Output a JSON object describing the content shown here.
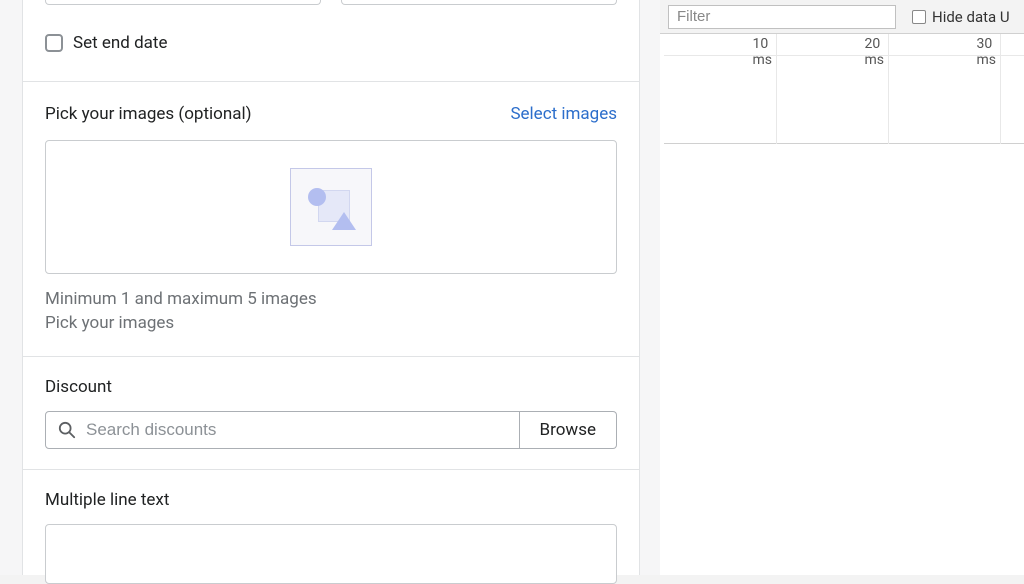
{
  "form": {
    "set_end_date_label": "Set end date",
    "images": {
      "title": "Pick your images (optional)",
      "select_link": "Select images",
      "help_line1": "Minimum 1 and maximum 5 images",
      "help_line2": "Pick your images"
    },
    "discount": {
      "title": "Discount",
      "search_placeholder": "Search discounts",
      "browse_label": "Browse"
    },
    "mlt": {
      "title": "Multiple line text"
    }
  },
  "devtools": {
    "filter_placeholder": "Filter",
    "hide_label": "Hide data U",
    "ruler": {
      "t1": "10 ms",
      "t2": "20 ms",
      "t3": "30 ms"
    }
  }
}
